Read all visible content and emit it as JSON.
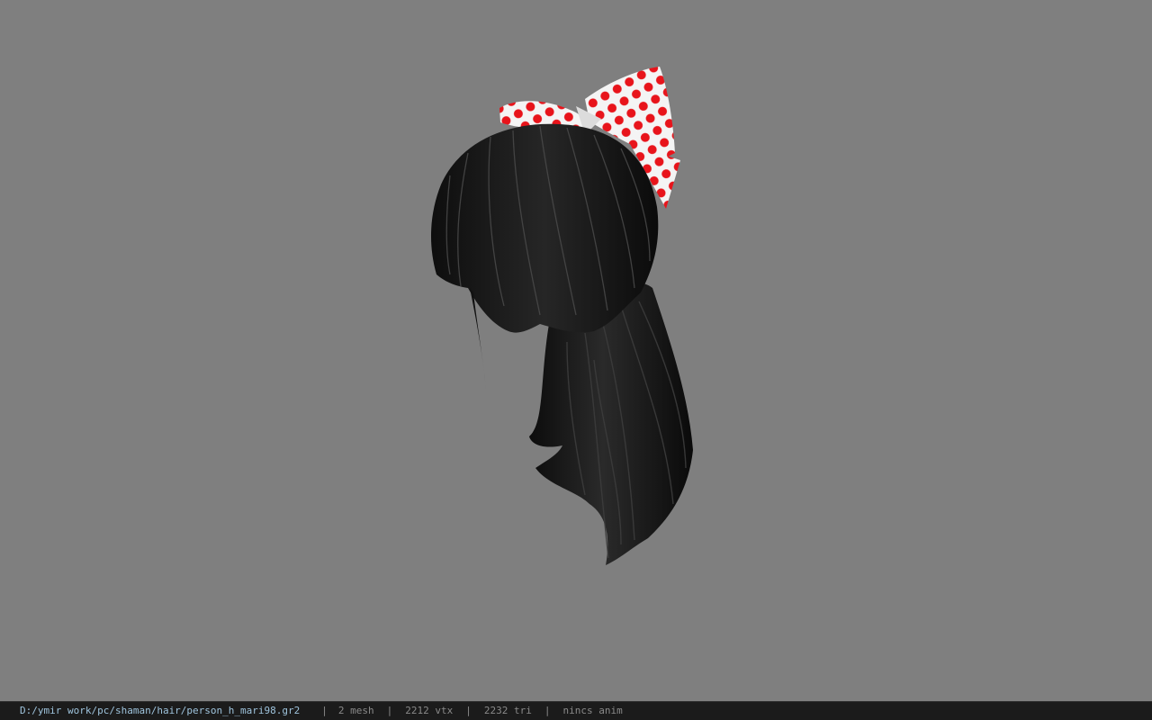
{
  "viewport": {
    "background": "#7f7f7f",
    "model_description_icon": "hair-model-icon"
  },
  "statusbar": {
    "file_path": "D:/ymir work/pc/shaman/hair/person_h_mari98.gr2",
    "separator": "|",
    "mesh_count": "2 mesh",
    "vertex_count": "2212 vtx",
    "triangle_count": "2232 tri",
    "anim_status": "nincs anim",
    "path_color": "#9ec3dc",
    "text_color": "#8a8a8a"
  }
}
